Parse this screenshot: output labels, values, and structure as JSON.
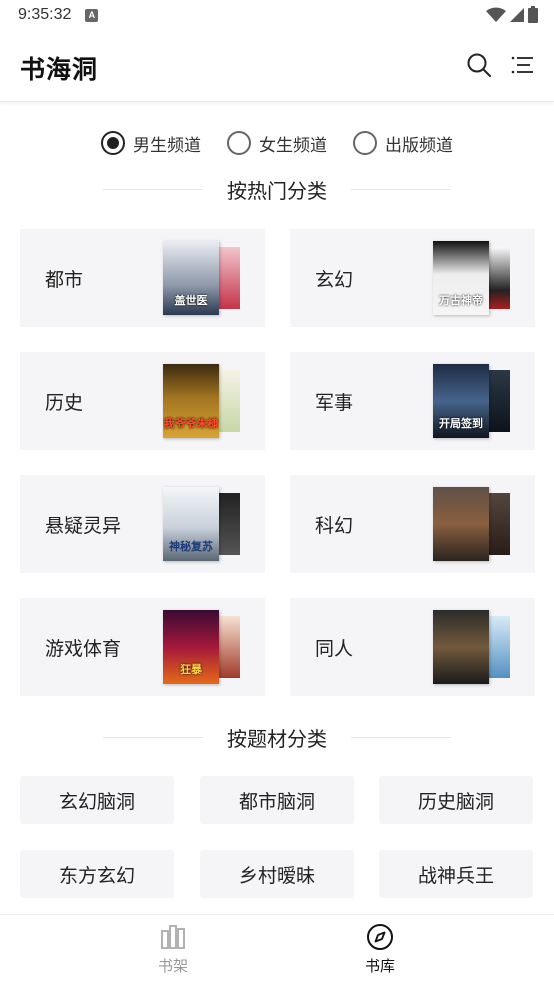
{
  "status_bar": {
    "time": "9:35:32",
    "notif_letter": "A"
  },
  "header": {
    "title": "书海洞"
  },
  "channels": [
    {
      "label": "男生频道",
      "checked": true
    },
    {
      "label": "女生频道",
      "checked": false
    },
    {
      "label": "出版频道",
      "checked": false
    }
  ],
  "hot_section": {
    "title": "按热门分类",
    "categories": [
      {
        "label": "都市",
        "cover_text": "盖世医"
      },
      {
        "label": "玄幻",
        "cover_text": "万古神帝"
      },
      {
        "label": "历史",
        "cover_text": "我爷爷朱棣"
      },
      {
        "label": "军事",
        "cover_text": "开局签到"
      },
      {
        "label": "悬疑灵异",
        "cover_text": "神秘复苏"
      },
      {
        "label": "科幻",
        "cover_text": ""
      },
      {
        "label": "游戏体育",
        "cover_text": "狂暴"
      },
      {
        "label": "同人",
        "cover_text": ""
      }
    ]
  },
  "theme_section": {
    "title": "按题材分类",
    "items": [
      "玄幻脑洞",
      "都市脑洞",
      "历史脑洞",
      "东方玄幻",
      "乡村暧昧",
      "战神兵王"
    ]
  },
  "bottom_nav": [
    {
      "label": "书架",
      "active": false
    },
    {
      "label": "书库",
      "active": true
    }
  ],
  "colors": {
    "card_bg": "#f5f5f7",
    "active": "#222222",
    "inactive": "#999999"
  }
}
